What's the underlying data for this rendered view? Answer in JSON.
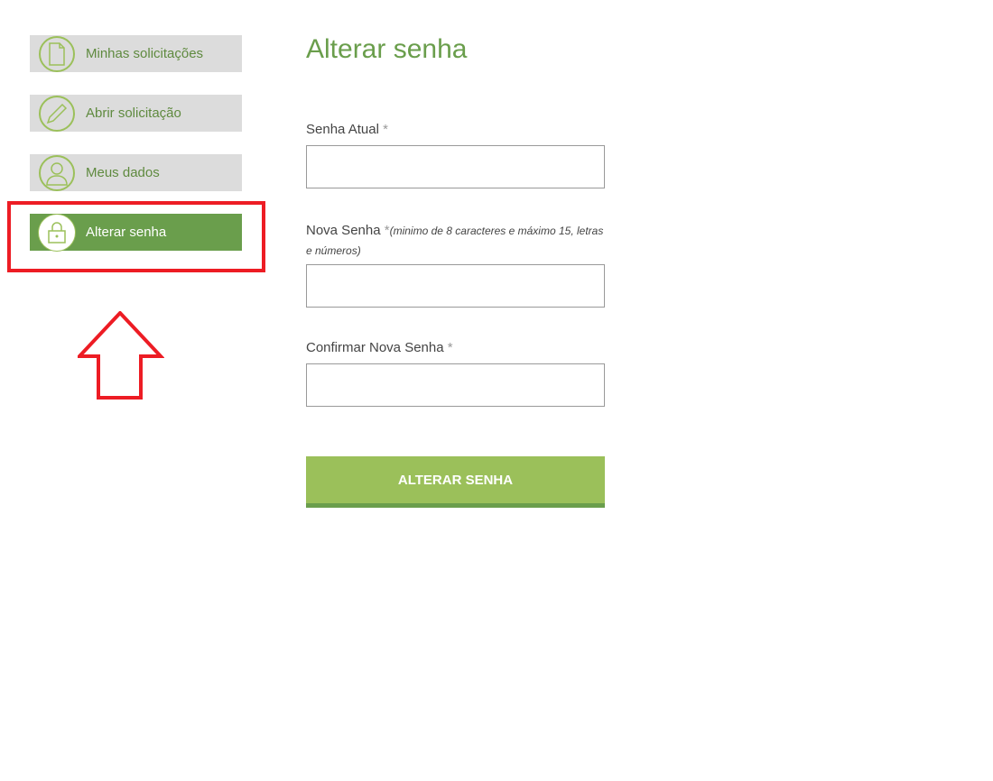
{
  "sidebar": {
    "items": [
      {
        "label": "Minhas solicitações",
        "icon": "document-icon"
      },
      {
        "label": "Abrir solicitação",
        "icon": "pencil-icon"
      },
      {
        "label": "Meus dados",
        "icon": "user-icon"
      },
      {
        "label": "Alterar senha",
        "icon": "lock-icon",
        "active": true
      }
    ]
  },
  "main": {
    "title": "Alterar senha",
    "fields": [
      {
        "label": "Senha Atual",
        "required": "*",
        "hint": ""
      },
      {
        "label": "Nova Senha",
        "required": "*",
        "hint": "(minimo de 8 caracteres e máximo 15, letras e números)"
      },
      {
        "label": "Confirmar Nova Senha",
        "required": "*",
        "hint": ""
      }
    ],
    "submit_label": "ALTERAR SENHA"
  },
  "colors": {
    "accent": "#6a9e4c",
    "button": "#9bc05a",
    "highlight": "#ed1c24"
  }
}
